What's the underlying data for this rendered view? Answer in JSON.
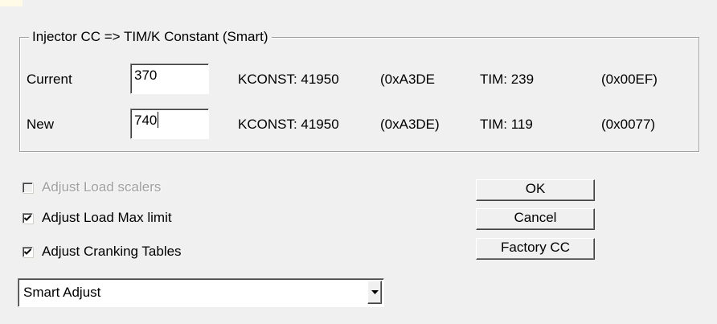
{
  "group": {
    "title": "Injector CC => TIM/K Constant (Smart)",
    "rows": [
      {
        "label": "Current",
        "value": "370",
        "kconst": "KCONST: 41950",
        "kconst_hex": "(0xA3DE)",
        "tim": "TIM: 239",
        "tim_hex": "(0x00EF)"
      },
      {
        "label": "New",
        "value": "740",
        "kconst": "KCONST: 41950",
        "kconst_hex": "(0xA3DE)",
        "tim": "TIM: 119",
        "tim_hex": "(0x0077)"
      }
    ]
  },
  "options": [
    {
      "label": "Adjust Load scalers",
      "checked": false,
      "disabled": true
    },
    {
      "label": "Adjust Load Max limit",
      "checked": true,
      "disabled": false
    },
    {
      "label": "Adjust Cranking Tables",
      "checked": true,
      "disabled": false
    }
  ],
  "buttons": {
    "ok": "OK",
    "cancel": "Cancel",
    "factory": "Factory CC"
  },
  "mode_select": {
    "value": "Smart Adjust"
  }
}
